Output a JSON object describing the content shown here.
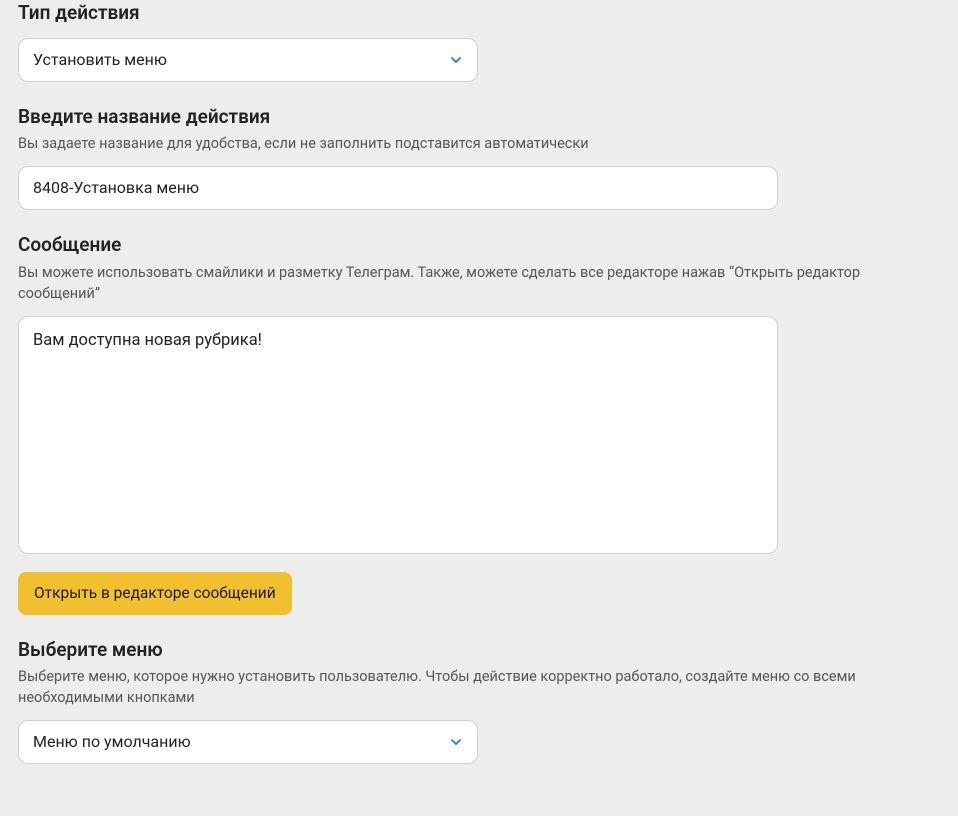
{
  "actionType": {
    "label": "Тип действия",
    "selected": "Установить меню"
  },
  "actionName": {
    "label": "Введите название действия",
    "help": "Вы задаете название для удобства, если не заполнить подставится автоматически",
    "value": "8408-Установка меню"
  },
  "message": {
    "label": "Сообщение",
    "help": "Вы можете использовать смайлики и разметку Телеграм. Также, можете сделать все редакторе нажав “Открыть редактор сообщений”",
    "value": "Вам доступна новая рубрика!",
    "button": "Открыть в редакторе сообщений"
  },
  "menuSelect": {
    "label": "Выберите меню",
    "help": "Выберите меню, которое нужно установить пользователю. Чтобы действие корректно работало, создайте меню со всеми необходимыми кнопками",
    "selected": "Меню по умолчанию"
  },
  "colors": {
    "accentBlue": "#1d7aed",
    "buttonYellow": "#f0c02f"
  }
}
